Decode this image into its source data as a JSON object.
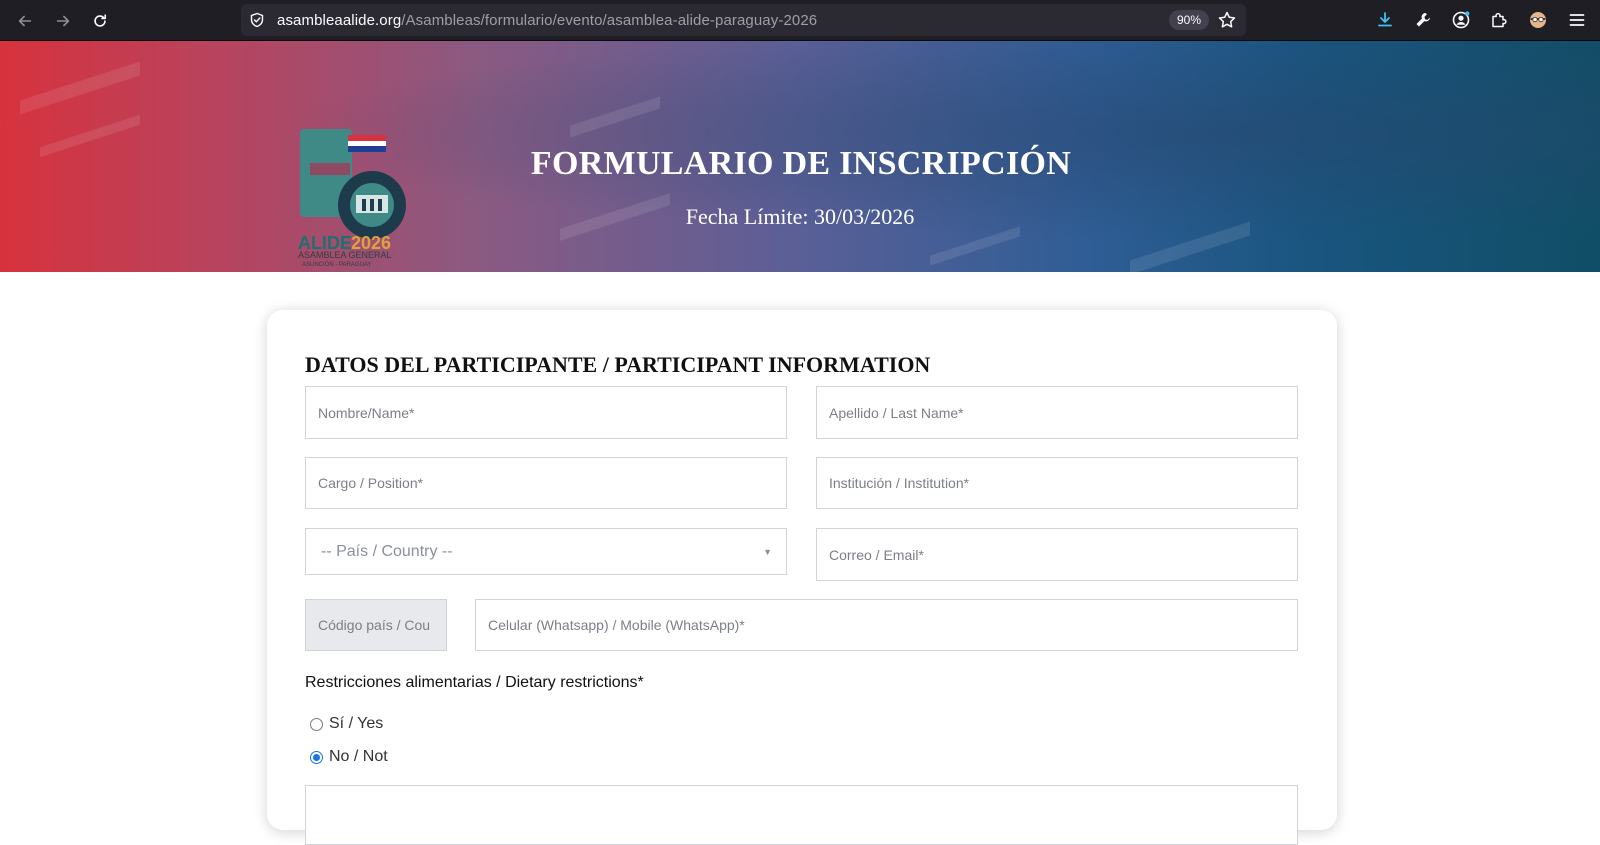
{
  "browser": {
    "url_domain": "asambleaalide.org",
    "url_path": "/Asambleas/formulario/evento/asamblea-alide-paraguay-2026",
    "zoom": "90%"
  },
  "banner": {
    "title": "FORMULARIO DE INSCRIPCIÓN",
    "deadline": "Fecha Límite: 30/03/2026",
    "logo": {
      "number": "56",
      "brand": "ALIDE2026",
      "subtitle": "ASAMBLEA GENERAL",
      "location": "ASUNCIÓN - PARAGUAY"
    }
  },
  "form": {
    "section_title": "DATOS DEL PARTICIPANTE / PARTICIPANT INFORMATION",
    "first_name_placeholder": "Nombre/Name*",
    "last_name_placeholder": "Apellido / Last Name*",
    "position_placeholder": "Cargo / Position*",
    "institution_placeholder": "Institución / Institution*",
    "country_select": "-- País / Country --",
    "email_placeholder": "Correo / Email*",
    "country_code_placeholder": "Código país /  Cou",
    "mobile_placeholder": "Celular (Whatsapp) / Mobile (WhatsApp)*",
    "dietary_label": "Restricciones alimentarias / Dietary restrictions*",
    "dietary_options": [
      {
        "label": "Sí / Yes",
        "checked": false
      },
      {
        "label": "No / Not",
        "checked": true
      }
    ]
  },
  "colors": {
    "accent": "#1a73e8",
    "banner_start": "#d7323d",
    "banner_end": "#104e66"
  },
  "icons": [
    "back-arrow-icon",
    "forward-arrow-icon",
    "reload-icon",
    "shield-icon",
    "star-icon",
    "download-icon",
    "wrench-icon",
    "account-icon",
    "extensions-icon",
    "profile-avatar-icon",
    "menu-icon"
  ]
}
